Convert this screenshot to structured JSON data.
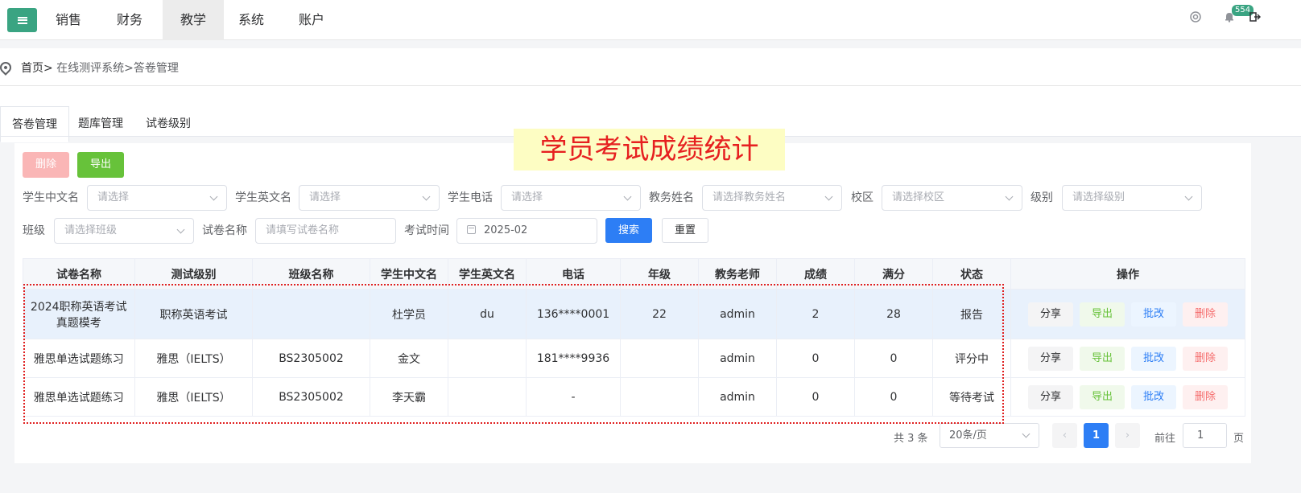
{
  "nav": {
    "items": [
      "销售",
      "财务",
      "教学",
      "系统",
      "账户"
    ],
    "active": "教学",
    "notification_count": "554"
  },
  "breadcrumb": {
    "home": "首页>",
    "path": " 在线测评系统>答卷管理"
  },
  "tabs": [
    "答卷管理",
    "题库管理",
    "试卷级别"
  ],
  "overlay_title": "学员考试成绩统计",
  "toolbar": {
    "delete_label": "删除",
    "export_label": "导出"
  },
  "filters": {
    "cn_name": {
      "label": "学生中文名",
      "placeholder": "请选择"
    },
    "en_name": {
      "label": "学生英文名",
      "placeholder": "请选择"
    },
    "phone": {
      "label": "学生电话",
      "placeholder": "请选择"
    },
    "teacher": {
      "label": "教务姓名",
      "placeholder": "请选择教务姓名"
    },
    "campus": {
      "label": "校区",
      "placeholder": "请选择校区"
    },
    "level": {
      "label": "级别",
      "placeholder": "请选择级别"
    },
    "class": {
      "label": "班级",
      "placeholder": "请选择班级"
    },
    "paper": {
      "label": "试卷名称",
      "placeholder": "请填写试卷名称"
    },
    "time": {
      "label": "考试时间",
      "value": "2025-02"
    },
    "search_label": "搜索",
    "reset_label": "重置"
  },
  "table": {
    "headers": [
      "试卷名称",
      "测试级别",
      "班级名称",
      "学生中文名",
      "学生英文名",
      "电话",
      "年级",
      "教务老师",
      "成绩",
      "满分",
      "状态",
      "操作"
    ],
    "rows": [
      {
        "paper_l1": "2024职称英语考试",
        "paper_l2": "真题模考",
        "level": "职称英语考试",
        "class": "",
        "cn": "杜学员",
        "en": "du",
        "phone": "136****0001",
        "grade": "22",
        "teacher": "admin",
        "score": "2",
        "full": "28",
        "status": "报告"
      },
      {
        "paper_l1": "雅思单选试题练习",
        "paper_l2": "",
        "level": "雅思（IELTS）",
        "class": "BS2305002",
        "cn": "金文",
        "en": "",
        "phone": "181****9936",
        "grade": "",
        "teacher": "admin",
        "score": "0",
        "full": "0",
        "status": "评分中"
      },
      {
        "paper_l1": "雅思单选试题练习",
        "paper_l2": "",
        "level": "雅思（IELTS）",
        "class": "BS2305002",
        "cn": "李天霸",
        "en": "",
        "phone": "-",
        "grade": "",
        "teacher": "admin",
        "score": "0",
        "full": "0",
        "status": "等待考试"
      }
    ],
    "ops": {
      "share": "分享",
      "export": "导出",
      "grade": "批改",
      "delete": "删除"
    }
  },
  "pagination": {
    "total": "共 3 条",
    "page_size": "20条/页",
    "current_page": "1",
    "goto_label": "前往",
    "goto_value": "1",
    "page_unit": "页"
  }
}
